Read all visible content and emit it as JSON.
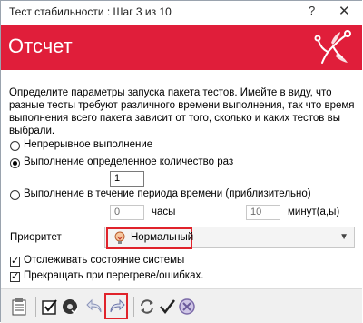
{
  "window": {
    "title": "Тест стабильности : Шаг 3 из 10",
    "help_label": "?",
    "close_label": "✕"
  },
  "banner": {
    "title": "Отсчет"
  },
  "description": "Определите параметры запуска пакета тестов. Имейте в виду, что разные тесты требуют различного времени выполнения, так что время выполнения всего пакета зависит от того, сколько и каких тестов вы выбрали.",
  "options": {
    "continuous": {
      "label": "Непрерывное выполнение",
      "selected": false
    },
    "count": {
      "label": "Выполнение определенное количество раз",
      "selected": true,
      "value": "1"
    },
    "period": {
      "label": "Выполнение в течение периода времени (приблизительно)",
      "selected": false,
      "hours_value": "0",
      "hours_unit": "часы",
      "minutes_value": "10",
      "minutes_unit": "минут(а,ы)"
    }
  },
  "priority": {
    "label": "Приоритет",
    "value": "Нормальный"
  },
  "checkboxes": {
    "monitor": {
      "label": "Отслеживать состояние системы",
      "checked": true
    },
    "stop": {
      "label": "Прекращать при перегреве/ошибках.",
      "checked": true
    }
  },
  "colors": {
    "banner": "#e01e3a",
    "highlight": "#e0232b"
  },
  "toolbar_icons": [
    "clipboard-icon",
    "check-report-icon",
    "disk-check-icon",
    "back-arrow-icon",
    "forward-arrow-icon",
    "refresh-icon",
    "checkmark-icon",
    "cancel-icon"
  ]
}
